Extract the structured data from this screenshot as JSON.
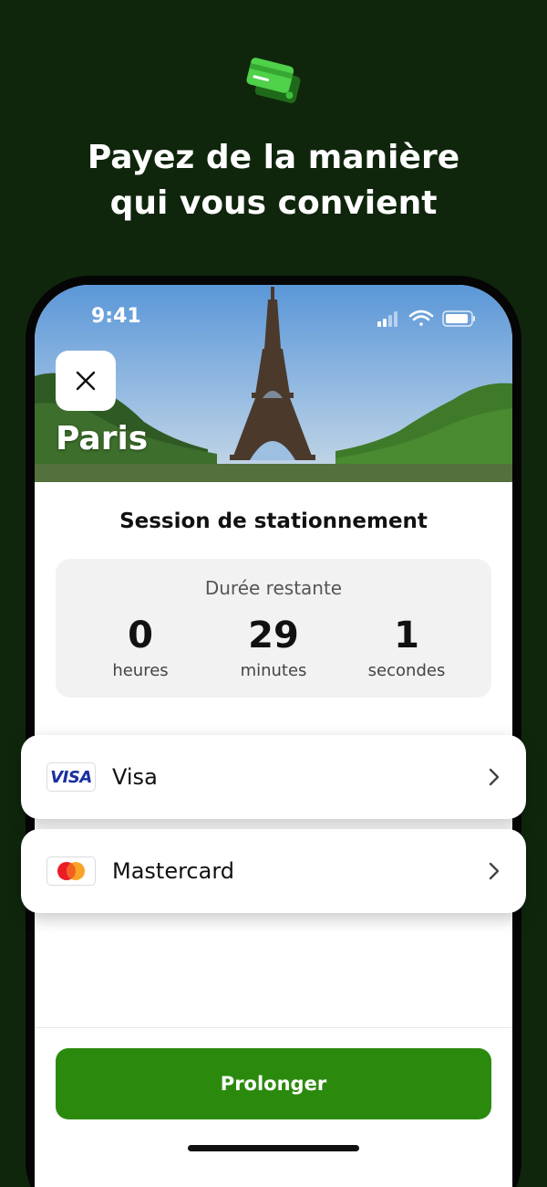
{
  "colors": {
    "background": "#0f260c",
    "accent": "#2b8a0e",
    "promo_card": "#3cc23a"
  },
  "headline": {
    "line1": "Payez de la manière",
    "line2": "qui vous convient"
  },
  "status_bar": {
    "time": "9:41",
    "icons": [
      "signal-icon",
      "wifi-icon",
      "battery-icon"
    ]
  },
  "header": {
    "close_icon": "close-icon",
    "city": "Paris"
  },
  "session": {
    "title": "Session de stationnement",
    "timer_label": "Durée restante",
    "units": [
      {
        "value": "0",
        "label": "heures"
      },
      {
        "value": "29",
        "label": "minutes"
      },
      {
        "value": "1",
        "label": "secondes"
      }
    ]
  },
  "payment_methods": [
    {
      "logo_text": "VISA",
      "name": "Visa",
      "icon": "chevron-right-icon"
    },
    {
      "logo_text": "",
      "name": "Mastercard",
      "icon": "chevron-right-icon"
    }
  ],
  "cta": {
    "label": "Prolonger"
  }
}
